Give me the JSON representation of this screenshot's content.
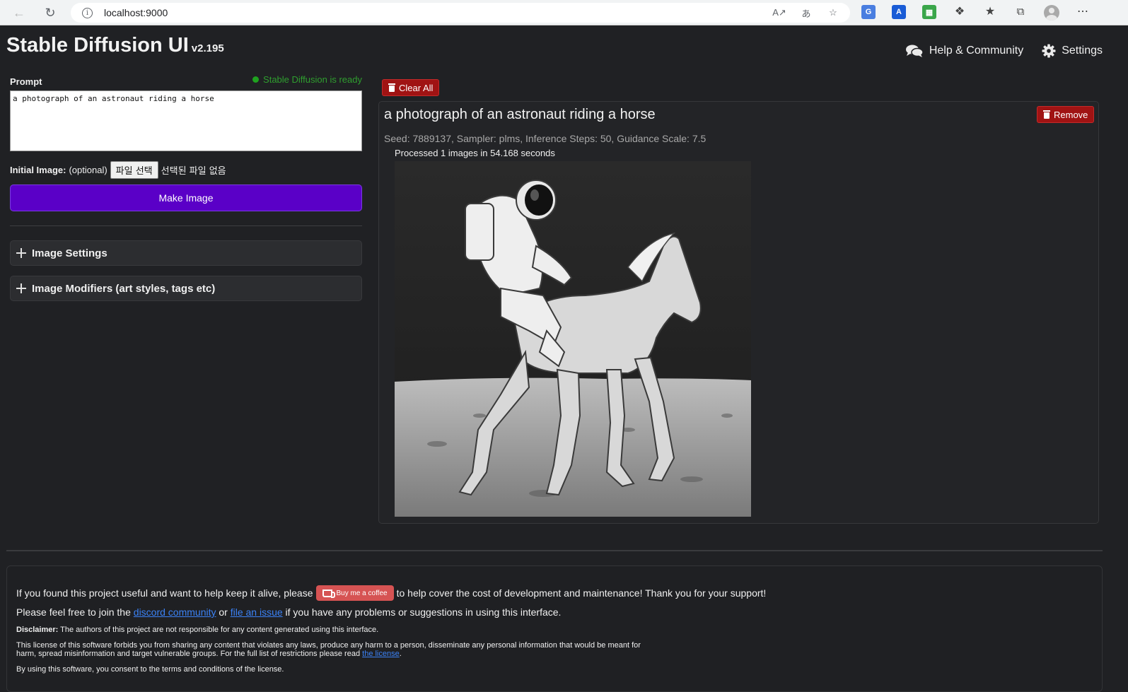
{
  "browser": {
    "url": "localhost:9000"
  },
  "app": {
    "title": "Stable Diffusion UI",
    "version": "v2.195",
    "links": {
      "help": "Help & Community",
      "settings": "Settings"
    }
  },
  "editor": {
    "prompt_label": "Prompt",
    "status": "Stable Diffusion is ready",
    "prompt_value": "a photograph of an astronaut riding a horse",
    "initial_image_label": "Initial Image:",
    "initial_image_optional": "(optional)",
    "file_button": "파일 선택",
    "file_none": "선택된 파일 없음",
    "make_button": "Make Image",
    "accordions": [
      {
        "label": "Image Settings"
      },
      {
        "label": "Image Modifiers (art styles, tags etc)"
      }
    ]
  },
  "results": {
    "clear_all": "Clear All",
    "items": [
      {
        "title": "a photograph of an astronaut riding a horse",
        "remove": "Remove",
        "meta": "Seed: 7889137, Sampler: plms, Inference Steps: 50, Guidance Scale: 7.5",
        "processed": "Processed 1 images in 54.168 seconds"
      }
    ]
  },
  "footer": {
    "line1_pre": "If you found this project useful and want to help keep it alive, please",
    "coffee_label": "Buy me a coffee",
    "line1_post": "to help cover the cost of development and maintenance! Thank you for your support!",
    "line2_pre": "Please feel free to join the",
    "discord_link": "discord community",
    "line2_mid": "or",
    "issue_link": "file an issue",
    "line2_post": "if you have any problems or suggestions in using this interface.",
    "disclaimer_label": "Disclaimer:",
    "disclaimer_text": "The authors of this project are not responsible for any content generated using this interface.",
    "license_text": "This license of this software forbids you from sharing any content that violates any laws, produce any harm to a person, disseminate any personal information that would be meant for harm, spread misinformation and target vulnerable groups. For the full list of restrictions please read",
    "license_link": "the license",
    "consent_text": "By using this software, you consent to the terms and conditions of the license."
  },
  "colors": {
    "accent": "#5a00c7",
    "danger": "#a01313",
    "ready": "#1fa21f",
    "link": "#3b82f6",
    "coffee": "#d65353"
  }
}
